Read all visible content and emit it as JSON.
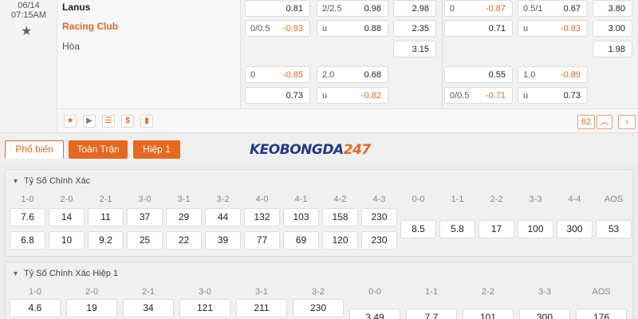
{
  "match": {
    "date": "06/14",
    "time": "07:15AM",
    "home_team": "Lanus",
    "away_team": "Racing Club",
    "draw_label": "Hòa",
    "row1": [
      {
        "lbl": "",
        "val": "0.81"
      },
      {
        "lbl": "2/2.5",
        "val": "0.98"
      },
      {
        "lbl": "",
        "val": "2.98"
      },
      {
        "lbl": "0",
        "val": "-0.87"
      },
      {
        "lbl": "0.5/1",
        "val": "0.67"
      },
      {
        "lbl": "",
        "val": "3.80"
      }
    ],
    "row2": [
      {
        "lbl": "0/0.5",
        "val": "-0.93"
      },
      {
        "lbl": "u",
        "val": "0.88"
      },
      {
        "lbl": "",
        "val": "2.35"
      },
      {
        "lbl": "",
        "val": "0.71"
      },
      {
        "lbl": "u",
        "val": "-0.83"
      },
      {
        "lbl": "",
        "val": "3.00"
      }
    ],
    "row3": [
      {
        "lbl": "",
        "val": "3.15"
      },
      {
        "lbl": "",
        "val": "1.98"
      }
    ],
    "row4": [
      {
        "lbl": "0",
        "val": "-0.85"
      },
      {
        "lbl": "2.0",
        "val": "0.68"
      },
      {
        "lbl": "",
        "val": "0.55"
      },
      {
        "lbl": "1.0",
        "val": "-0.89"
      }
    ],
    "row5": [
      {
        "lbl": "",
        "val": "0.73"
      },
      {
        "lbl": "u",
        "val": "-0.82"
      },
      {
        "lbl": "0/0.5",
        "val": "-0.71"
      },
      {
        "lbl": "u",
        "val": "0.73"
      }
    ],
    "toolbar": {
      "icons": [
        "star-icon",
        "play-icon",
        "stats-box-icon",
        "dollar-icon",
        "bar-chart-icon"
      ],
      "page_count": "62"
    }
  },
  "tabs": {
    "popular": "Phổ biến",
    "full_match": "Toàn Trận",
    "half1": "Hiệp 1"
  },
  "logo": {
    "part1": "KEOBONGDA",
    "part2": "247"
  },
  "panel1": {
    "title": "Tỷ Số Chính Xác",
    "headers": [
      "1-0",
      "2-0",
      "2-1",
      "3-0",
      "3-1",
      "3-2",
      "4-0",
      "4-1",
      "4-2",
      "4-3",
      "0-0",
      "1-1",
      "2-2",
      "3-3",
      "4-4",
      "AOS"
    ],
    "row_a": [
      "7.6",
      "14",
      "11",
      "37",
      "29",
      "44",
      "132",
      "103",
      "158",
      "230"
    ],
    "row_b": [
      "6.8",
      "10",
      "9.2",
      "25",
      "22",
      "39",
      "77",
      "69",
      "120",
      "230"
    ],
    "mid": [
      "8.5",
      "5.8",
      "17",
      "100",
      "300",
      "53"
    ]
  },
  "panel2": {
    "title": "Tỷ Số Chính Xác Hiệp 1",
    "headers": [
      "1-0",
      "2-0",
      "2-1",
      "3-0",
      "3-1",
      "3-2",
      "0-0",
      "1-1",
      "2-2",
      "3-3",
      "AOS"
    ],
    "row_a": [
      "4.6",
      "19",
      "34",
      "121",
      "211",
      "230"
    ],
    "mid": [
      "3.49",
      "7.7",
      "101",
      "300",
      "176"
    ]
  },
  "colors": {
    "accent": "#e8671e",
    "logo_blue": "#1f3c88",
    "negative": "#e8671e"
  }
}
